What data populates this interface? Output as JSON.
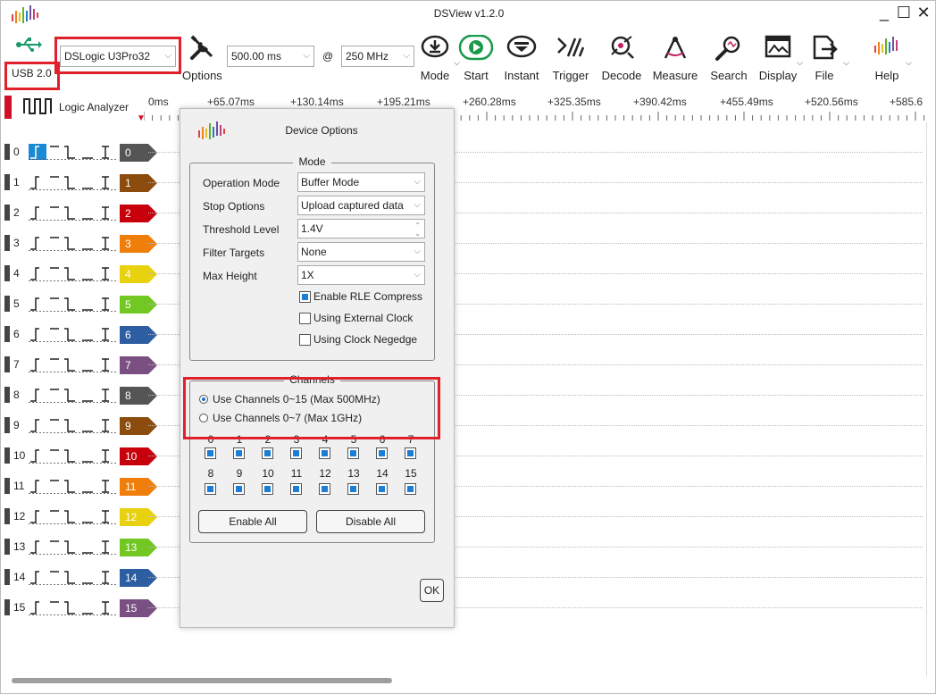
{
  "window": {
    "title": "DSView v1.2.0",
    "min": "_",
    "max": "☐",
    "close": "✕"
  },
  "toolbar": {
    "usb_label": "USB 2.0",
    "device": "DSLogic U3Pro32",
    "options_label": "Options",
    "duration": "500.00 ms",
    "at": "@",
    "rate": "250 MHz",
    "buttons": {
      "mode": "Mode",
      "start": "Start",
      "instant": "Instant",
      "trigger": "Trigger",
      "decode": "Decode",
      "measure": "Measure",
      "search": "Search",
      "display": "Display",
      "file": "File",
      "help": "Help"
    }
  },
  "analyzer": {
    "label": "Logic Analyzer"
  },
  "ruler": {
    "ticks": [
      "0ms",
      "+65.07ms",
      "+130.14ms",
      "+195.21ms",
      "+260.28ms",
      "+325.35ms",
      "+390.42ms",
      "+455.49ms",
      "+520.56ms",
      "+585.6"
    ]
  },
  "channels": [
    {
      "index": "0",
      "label": "0",
      "color": "#555555"
    },
    {
      "index": "1",
      "label": "1",
      "color": "#8b4c0e"
    },
    {
      "index": "2",
      "label": "2",
      "color": "#c8000b"
    },
    {
      "index": "3",
      "label": "3",
      "color": "#f07e0a"
    },
    {
      "index": "4",
      "label": "4",
      "color": "#e8d10d"
    },
    {
      "index": "5",
      "label": "5",
      "color": "#72c722"
    },
    {
      "index": "6",
      "label": "6",
      "color": "#2d5ea2"
    },
    {
      "index": "7",
      "label": "7",
      "color": "#7a4f82"
    },
    {
      "index": "8",
      "label": "8",
      "color": "#555555"
    },
    {
      "index": "9",
      "label": "9",
      "color": "#8b4c0e"
    },
    {
      "index": "10",
      "label": "10",
      "color": "#c8000b"
    },
    {
      "index": "11",
      "label": "11",
      "color": "#f07e0a"
    },
    {
      "index": "12",
      "label": "12",
      "color": "#e8d10d"
    },
    {
      "index": "13",
      "label": "13",
      "color": "#72c722"
    },
    {
      "index": "14",
      "label": "14",
      "color": "#2d5ea2"
    },
    {
      "index": "15",
      "label": "15",
      "color": "#7a4f82"
    }
  ],
  "dialog": {
    "title": "Device Options",
    "mode_group": "Mode",
    "operation_mode_label": "Operation Mode",
    "operation_mode_value": "Buffer Mode",
    "stop_options_label": "Stop Options",
    "stop_options_value": "Upload captured data",
    "threshold_label": "Threshold Level",
    "threshold_value": "1.4V",
    "filter_label": "Filter Targets",
    "filter_value": "None",
    "max_height_label": "Max Height",
    "max_height_value": "1X",
    "rle_label": "Enable RLE Compress",
    "ext_clock_label": "Using External Clock",
    "clock_negedge_label": "Using Clock Negedge",
    "channels_group": "Channels",
    "radio_16": "Use Channels 0~15 (Max 500MHz)",
    "radio_8": "Use Channels 0~7 (Max 1GHz)",
    "channel_nums_top": [
      "0",
      "1",
      "2",
      "3",
      "4",
      "5",
      "6",
      "7"
    ],
    "channel_nums_bottom": [
      "8",
      "9",
      "10",
      "11",
      "12",
      "13",
      "14",
      "15"
    ],
    "enable_all": "Enable All",
    "disable_all": "Disable All",
    "ok": "OK"
  }
}
